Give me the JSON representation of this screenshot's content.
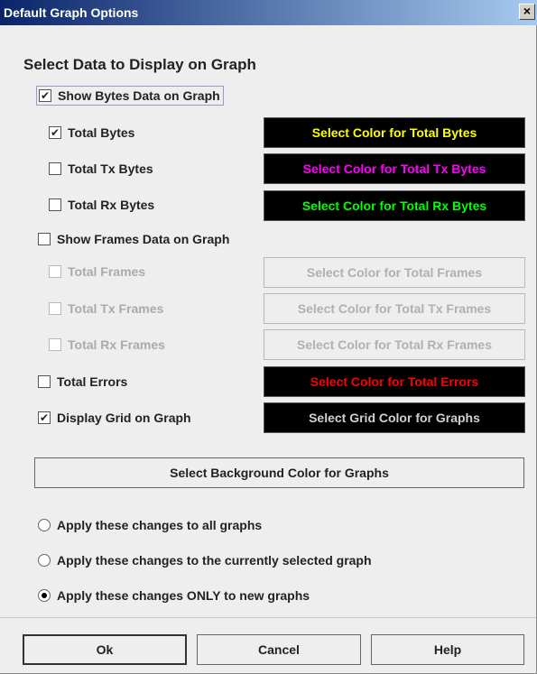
{
  "window": {
    "title": "Default Graph Options",
    "close_glyph": "×"
  },
  "section_title": "Select Data to Display on Graph",
  "bytes": {
    "show": {
      "label": "Show Bytes Data on Graph",
      "checked": true
    },
    "items": [
      {
        "label": "Total Bytes",
        "checked": true,
        "button": "Select Color for Total Bytes",
        "color": "#ffff00"
      },
      {
        "label": "Total Tx Bytes",
        "checked": false,
        "button": "Select Color for Total Tx Bytes",
        "color": "#ff00ff"
      },
      {
        "label": "Total Rx Bytes",
        "checked": false,
        "button": "Select Color for Total Rx Bytes",
        "color": "#00ff00"
      }
    ]
  },
  "frames": {
    "show": {
      "label": "Show Frames Data on Graph",
      "checked": false
    },
    "items": [
      {
        "label": "Total Frames",
        "checked": false,
        "enabled": false,
        "button": "Select Color for Total Frames"
      },
      {
        "label": "Total Tx Frames",
        "checked": false,
        "enabled": false,
        "button": "Select Color for Total Tx Frames"
      },
      {
        "label": "Total Rx Frames",
        "checked": false,
        "enabled": false,
        "button": "Select Color for Total Rx Frames"
      }
    ]
  },
  "errors": {
    "label": "Total Errors",
    "checked": false,
    "button": "Select Color for Total Errors",
    "color": "#ff0000"
  },
  "grid": {
    "label": "Display Grid on Graph",
    "checked": true,
    "button": "Select Grid Color for Graphs",
    "color": "#d0d0d0"
  },
  "background_button": "Select Background Color for Graphs",
  "apply_options": [
    {
      "label": "Apply these changes to all graphs",
      "selected": false
    },
    {
      "label": "Apply these changes to the currently selected graph",
      "selected": false
    },
    {
      "label": "Apply these changes ONLY to new graphs",
      "selected": true
    }
  ],
  "buttons": {
    "ok": "Ok",
    "cancel": "Cancel",
    "help": "Help"
  },
  "check_glyph": "✔"
}
